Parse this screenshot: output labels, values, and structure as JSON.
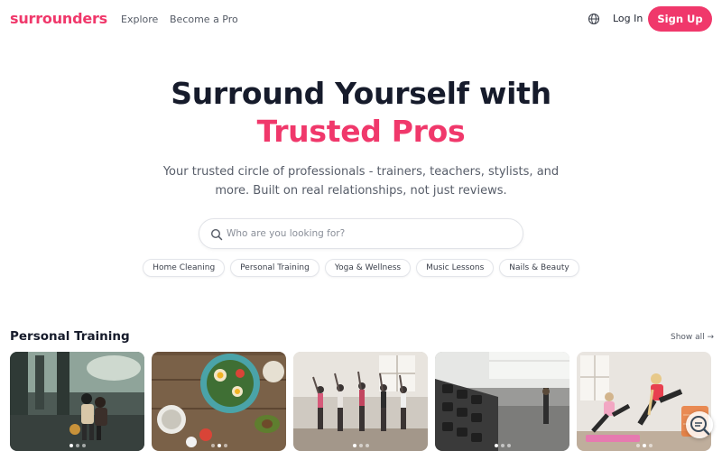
{
  "header": {
    "logo": "surrounders",
    "nav": {
      "explore": "Explore",
      "become_pro": "Become a Pro"
    },
    "globe_icon": "globe-icon",
    "login": "Log In",
    "signup": "Sign Up"
  },
  "hero": {
    "title_line1": "Surround Yourself with",
    "title_line2": "Trusted Pros",
    "subtitle": "Your trusted circle of professionals - trainers, teachers, stylists, and more. Built on real relationships, not just reviews."
  },
  "search": {
    "icon": "search-icon",
    "placeholder": "Who are you looking for?"
  },
  "chips": [
    "Home Cleaning",
    "Personal Training",
    "Yoga & Wellness",
    "Music Lessons",
    "Nails & Beauty"
  ],
  "section": {
    "title": "Personal Training",
    "show_all": "Show all →"
  },
  "cards": [
    {
      "image": "outdoor-basketball-court-friends",
      "slides": 3,
      "active_slide": 1
    },
    {
      "image": "healthy-food-salad-bowls",
      "slides": 3,
      "active_slide": 2
    },
    {
      "image": "group-fitness-class",
      "slides": 3,
      "active_slide": 1
    },
    {
      "image": "gym-dumbbell-rack",
      "slides": 3,
      "active_slide": 1
    },
    {
      "image": "women-exercising-on-mats",
      "slides": 3,
      "active_slide": 2
    }
  ],
  "colors": {
    "brand": "#f0386b",
    "text_dark": "#161b2b",
    "text_muted": "#575d69"
  }
}
